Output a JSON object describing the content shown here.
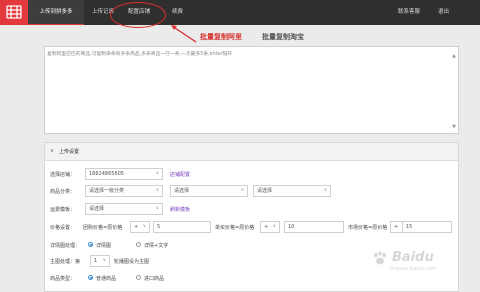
{
  "nav": {
    "items": [
      {
        "label": "上传到拼多多",
        "active": true
      },
      {
        "label": "上传记录",
        "active": false
      },
      {
        "label": "配置店铺",
        "active": false
      },
      {
        "label": "续费",
        "active": false
      }
    ],
    "right": [
      "联系客服",
      "退出"
    ]
  },
  "tabs": [
    "批量复制阿里",
    "批量复制淘宝"
  ],
  "paste_box": {
    "placeholder": "复制阿里巴巴的商品,可复制单条和多条商品,多条商品一行一条,一次最多5条,enter隔开",
    "scroll_up": "▲",
    "scroll_down": "▼"
  },
  "panel": {
    "chevron": "∨",
    "title": "上传设置",
    "shop": {
      "label": "选择店铺：",
      "value": "18624865605",
      "link": "店铺配置"
    },
    "category": {
      "label": "商品分类：",
      "level1": "请选择一级分类",
      "level2": "请选择",
      "level3": "请选择"
    },
    "freight": {
      "label": "运费模板：",
      "value": "请选择",
      "link": "刷新模板"
    },
    "price": {
      "label": "价格设置：",
      "group_text": "团购价格=原价格",
      "op1": "+",
      "val1": "5",
      "single_text": "单买价格=原价格",
      "op2": "+",
      "val2": "10",
      "market_text": "市场价格=原价格",
      "op3": "+",
      "val3": "15"
    },
    "detail": {
      "label": "详情图处理：",
      "option1": "详情图",
      "option2": "详情+文字"
    },
    "main_image": {
      "label": "主图处理：第",
      "value": "1",
      "suffix": "轮播图设为主图"
    },
    "goods_type": {
      "label": "商品类型：",
      "option1": "普通商品",
      "option2": "进口商品"
    }
  },
  "watermark": {
    "main": "Baidu",
    "sub": "jingyan.baidu.com"
  },
  "colors": {
    "accent": "#e4393c",
    "topbar": "#2f2f2f",
    "link": "#7b3fc0",
    "radio": "#3c8ed6"
  }
}
